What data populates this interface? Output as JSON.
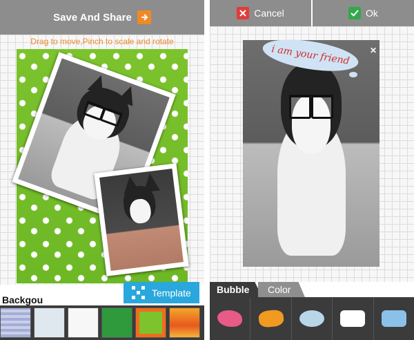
{
  "left": {
    "header": {
      "title": "Save And Share"
    },
    "hint": "Drag to move,Pinch to scale and rotate",
    "template_button": "Template",
    "bottom": {
      "tab_label": "Backgou",
      "thumbs": [
        "thumb-1",
        "thumb-2",
        "thumb-3",
        "thumb-4",
        "thumb-5",
        "thumb-6"
      ],
      "selected_index": 4
    }
  },
  "right": {
    "header": {
      "cancel": "Cancel",
      "ok": "Ok"
    },
    "bubble_text": "i am your friend",
    "tabs": {
      "active": "Bubble",
      "inactive": "Color"
    },
    "bubbles": [
      "pink-bubble",
      "orange-bubble",
      "blue-cloud-bubble",
      "white-bubble",
      "blue-bubble"
    ]
  },
  "icons": {
    "arrow": "right-arrow-icon",
    "cancel": "x-icon",
    "ok": "check-icon",
    "close": "close-icon",
    "template": "grid-dots-icon"
  },
  "colors": {
    "toolbar_gray": "#8d8d8d",
    "accent_orange": "#f08a24",
    "accent_blue": "#2aa7dc",
    "cancel_red": "#e23b3b",
    "ok_green": "#33a84a",
    "dark_strip": "#3b3b3b"
  }
}
